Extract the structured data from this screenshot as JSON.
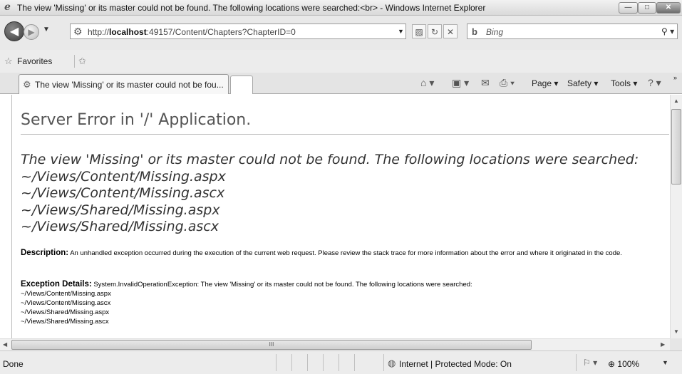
{
  "window": {
    "title": "The view 'Missing' or its master could not be found. The following locations were searched:<br> - Windows Internet Explorer",
    "buttons": {
      "minimize": "—",
      "maximize": "□",
      "close": "✕"
    }
  },
  "address": {
    "url_prefix": "http://",
    "url_host": "localhost",
    "url_rest": ":49157/Content/Chapters?ChapterID=0",
    "search_placeholder": "Bing"
  },
  "favorites": {
    "label": "Favorites"
  },
  "tabs": [
    {
      "label": "The view 'Missing' or its master could not be fou..."
    }
  ],
  "command_bar": {
    "page": "Page",
    "safety": "Safety",
    "tools": "Tools"
  },
  "page": {
    "title": "Server Error in '/' Application.",
    "error_lines": [
      "The view 'Missing' or its master could not be found. The following locations were searched:",
      "~/Views/Content/Missing.aspx",
      "~/Views/Content/Missing.ascx",
      "~/Views/Shared/Missing.aspx",
      "~/Views/Shared/Missing.ascx"
    ],
    "description_label": "Description:",
    "description_text": "An unhandled exception occurred during the execution of the current web request. Please review the stack trace for more information about the error and where it originated in the code.",
    "details_label": "Exception Details:",
    "details_text": "System.InvalidOperationException: The view 'Missing' or its master could not be found. The following locations were searched:",
    "details_lines": [
      "~/Views/Content/Missing.aspx",
      "~/Views/Content/Missing.ascx",
      "~/Views/Shared/Missing.aspx",
      "~/Views/Shared/Missing.ascx"
    ]
  },
  "status": {
    "done": "Done",
    "zone": "Internet | Protected Mode: On",
    "zoom": "100%"
  },
  "scroll": {
    "thumb_grip": "III"
  }
}
